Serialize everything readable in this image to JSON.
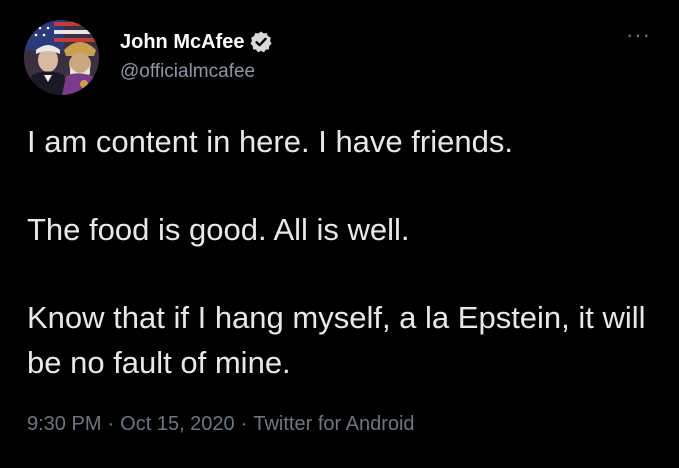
{
  "author": {
    "display_name": "John McAfee",
    "handle": "@officialmcafee",
    "verified_icon": "verified-badge-icon",
    "avatar": "profile-photo"
  },
  "more_icon": "more-options-icon",
  "tweet": {
    "paragraphs": [
      "I am content in here. I have friends.",
      "The food is good. All is well.",
      "Know that if I hang myself, a la Epstein, it will be no fault of mine."
    ],
    "time": "9:30 PM",
    "date": "Oct 15, 2020",
    "separator": "·",
    "source": "Twitter for Android"
  },
  "colors": {
    "background": "#000000",
    "text": "#e8e8e8",
    "secondary": "#6e767d",
    "handle": "#8b98a5"
  }
}
